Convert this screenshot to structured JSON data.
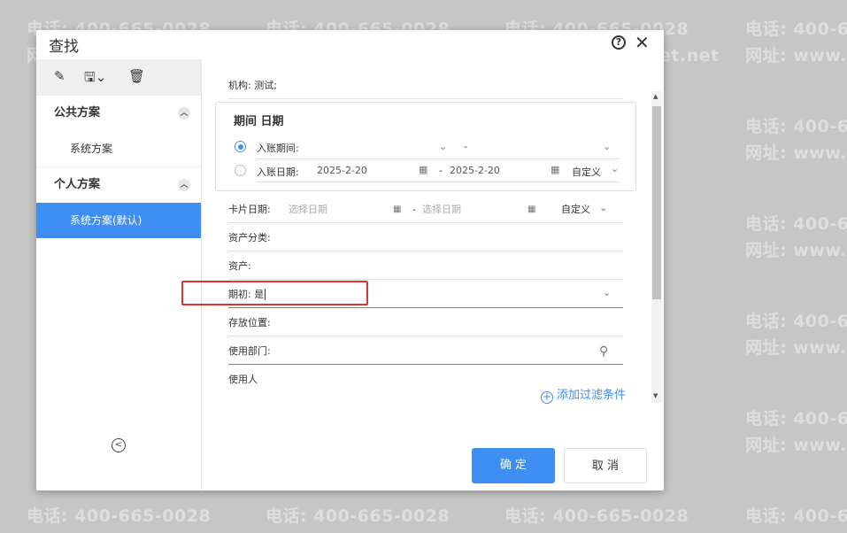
{
  "watermark": {
    "phone": "电话: 400-665-0028",
    "site": "网址: www.chanjet.net"
  },
  "dialog": {
    "title": "查找",
    "help_icon": "?",
    "close_icon": "✕"
  },
  "toolbar": {
    "edit_icon": "✎",
    "save_icon": "🖫⌄",
    "delete_icon": "🗑"
  },
  "sidebar": {
    "public_group": "公共方案",
    "public_items": [
      "系统方案"
    ],
    "personal_group": "个人方案",
    "personal_items": [
      "系统方案(默认)"
    ],
    "collapse_icon": "<"
  },
  "form": {
    "org_label": "机构:",
    "org_value": "测试;",
    "period_title": "期间 日期",
    "period_label": "入账期间:",
    "period_dash": "-",
    "date_label": "入账日期:",
    "date_from": "2025-2-20",
    "date_dash": "-",
    "date_to": "2025-2-20",
    "date_mode": "自定义",
    "card_date_label": "卡片日期:",
    "card_date_from_ph": "选择日期",
    "card_date_dash": "-",
    "card_date_to_ph": "选择日期",
    "card_date_mode": "自定义",
    "asset_class_label": "资产分类:",
    "asset_label": "资产:",
    "initial_label": "期初:",
    "initial_value": "是",
    "location_label": "存放位置:",
    "dept_label": "使用部门:",
    "user_label": "使用人"
  },
  "add_filter": "添加过滤条件",
  "buttons": {
    "ok": "确 定",
    "cancel": "取 消"
  }
}
